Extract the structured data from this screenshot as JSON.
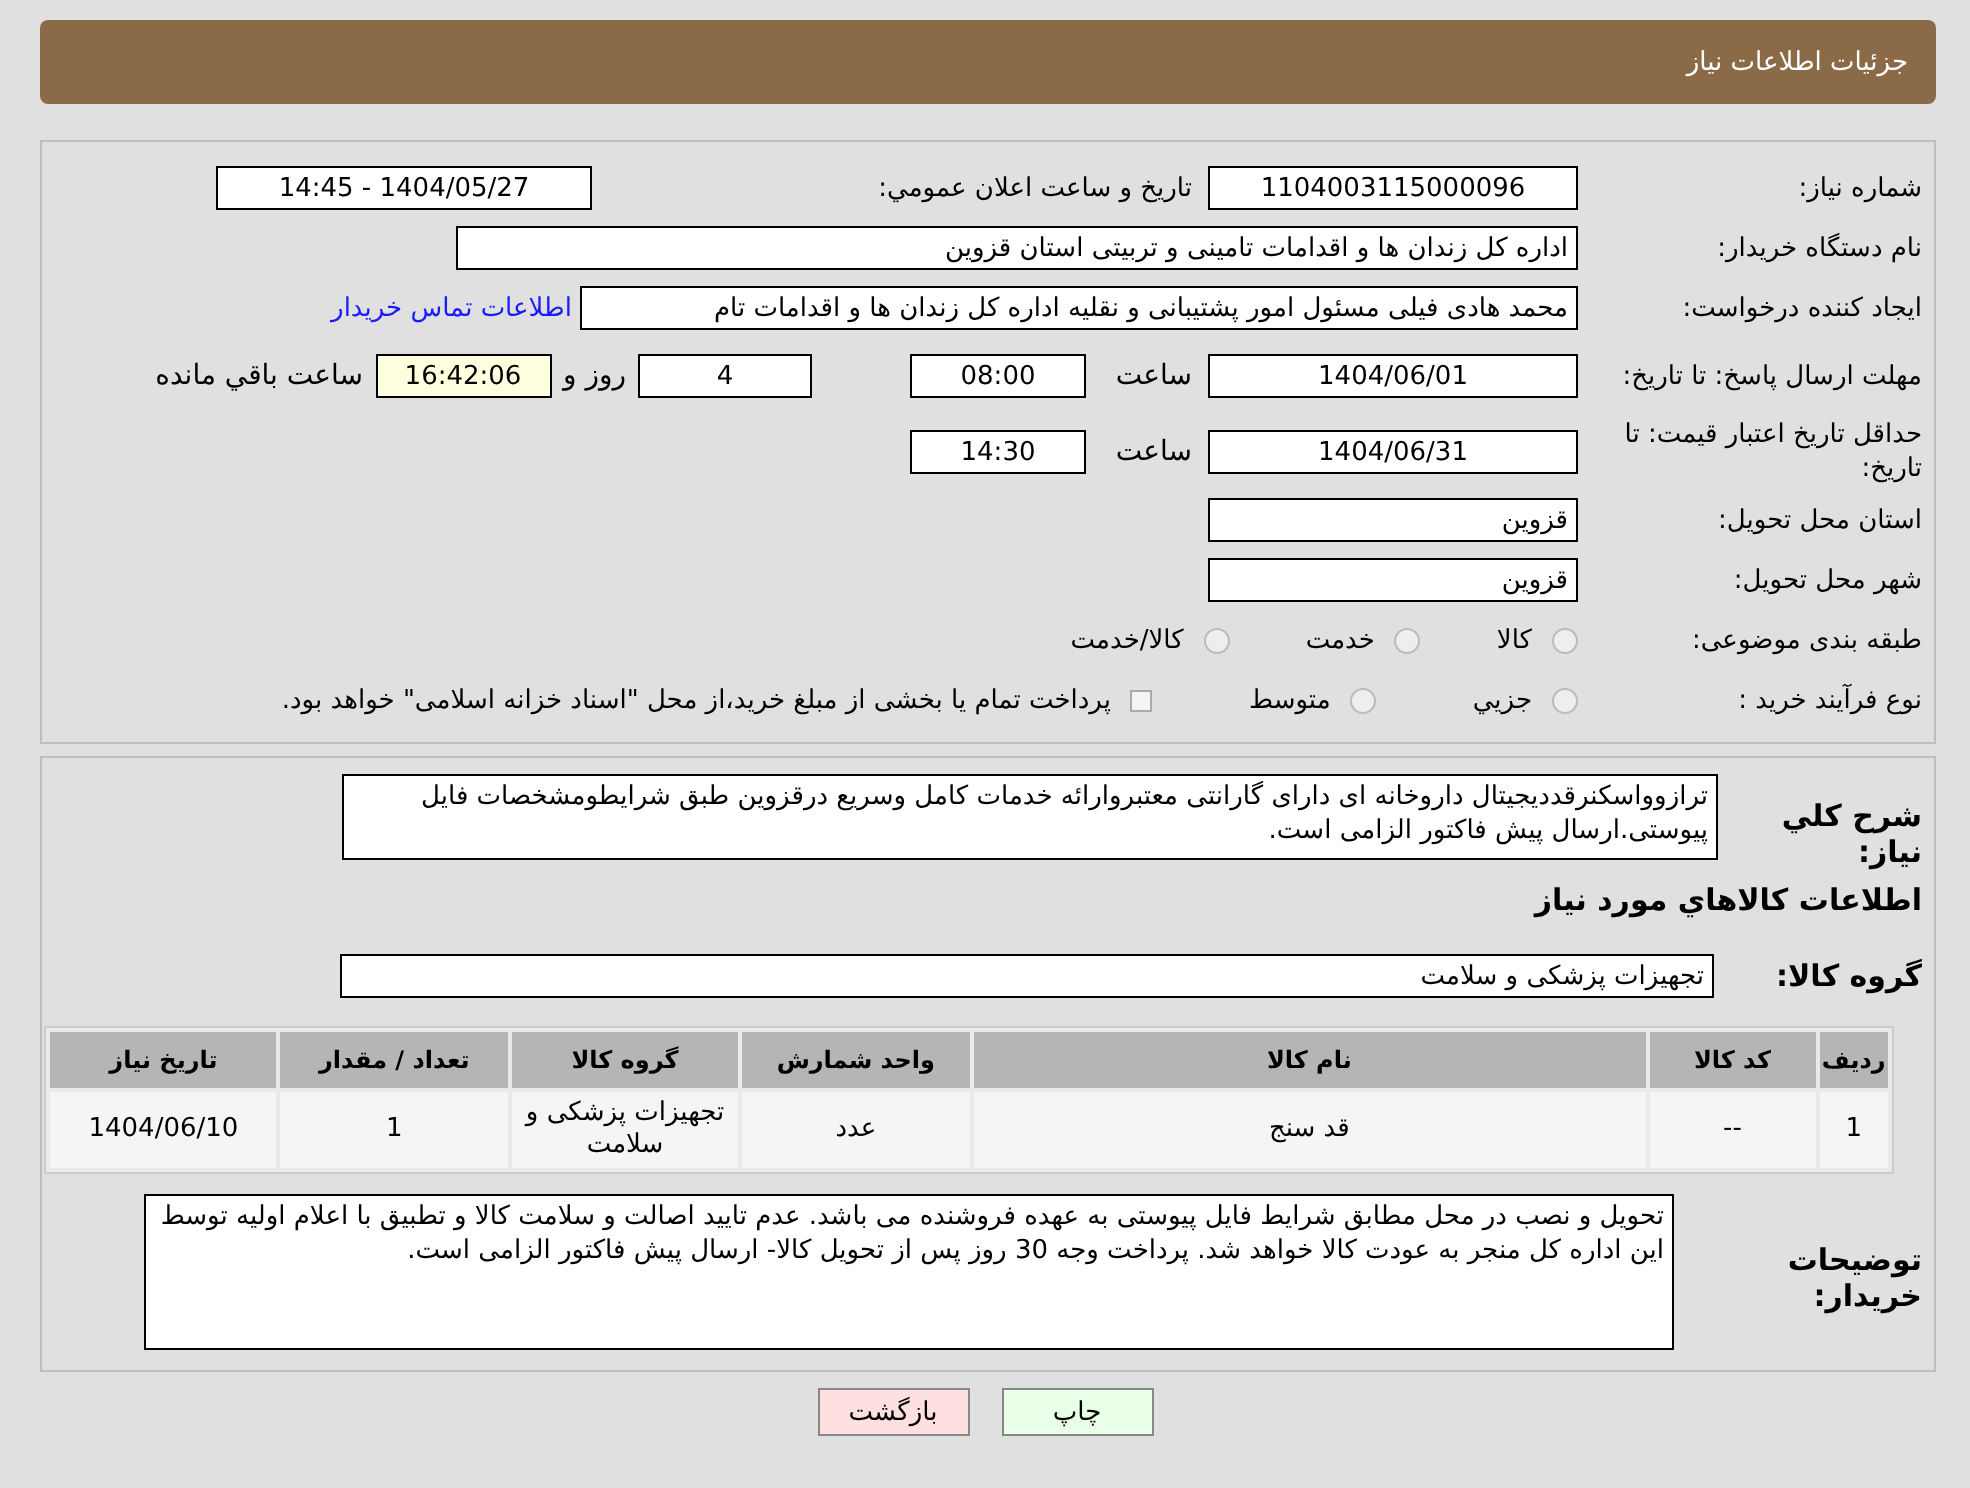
{
  "header": {
    "title": "جزئیات اطلاعات نیاز"
  },
  "need_number": {
    "label": "شماره نیاز:",
    "value": "1104003115000096"
  },
  "announce": {
    "label": "تاریخ و ساعت اعلان عمومي:",
    "value": "1404/05/27 - 14:45"
  },
  "buyer": {
    "label": "نام دستگاه خریدار:",
    "value": "اداره کل زندان ها و اقدامات تامینی و تربیتی استان قزوین"
  },
  "requester": {
    "label": "ایجاد کننده درخواست:",
    "value": "محمد هادی فیلی مسئول امور پشتیبانی و نقلیه اداره کل زندان ها و اقدامات تام",
    "link": "اطلاعات تماس خریدار"
  },
  "deadline": {
    "label": "مهلت ارسال پاسخ: تا تاریخ:",
    "date": "1404/06/01",
    "time_label": "ساعت",
    "time": "08:00",
    "days": "4",
    "days_label": "روز و",
    "remaining": "16:42:06",
    "remaining_label": "ساعت باقي مانده"
  },
  "validity": {
    "label": "حداقل تاریخ اعتبار قیمت: تا تاریخ:",
    "date": "1404/06/31",
    "time_label": "ساعت",
    "time": "14:30"
  },
  "province": {
    "label": "استان محل تحویل:",
    "value": "قزوین"
  },
  "city": {
    "label": "شهر محل تحویل:",
    "value": "قزوین"
  },
  "category": {
    "label": "طبقه بندی موضوعی:",
    "options": [
      {
        "label": "کالا",
        "selected": false
      },
      {
        "label": "خدمت",
        "selected": false
      },
      {
        "label": "کالا/خدمت",
        "selected": false
      }
    ]
  },
  "purchase_type": {
    "label": "نوع فرآیند خرید :",
    "options": [
      {
        "label": "جزيي",
        "selected": false
      },
      {
        "label": "متوسط",
        "selected": false
      }
    ],
    "treasury": {
      "checked": false,
      "text": "پرداخت تمام یا بخشی از مبلغ خرید،از محل \"اسناد خزانه اسلامی\" خواهد بود."
    }
  },
  "description": {
    "label": "شرح كلي نياز:",
    "value": "ترازوواسکنرقددیجیتال داروخانه ای دارای گارانتی معتبروارائه خدمات کامل وسریع درقزوین طبق شرایطومشخصات فایل پیوستی.ارسال پیش فاکتور الزامی است."
  },
  "goods_title": "اطلاعات كالاهاي مورد نياز",
  "goods_group": {
    "label": "گروه کالا:",
    "value": "تجهیزات پزشکی و سلامت"
  },
  "table": {
    "columns": [
      "ردیف",
      "کد کالا",
      "نام کالا",
      "واحد شمارش",
      "گروه کالا",
      "تعداد / مقدار",
      "تاریخ نیاز"
    ],
    "rows": [
      [
        "1",
        "--",
        "قد سنج",
        "عدد",
        "تجهیزات پزشکی و سلامت",
        "1",
        "1404/06/10"
      ]
    ]
  },
  "notes": {
    "label": "توضیحات خریدار:",
    "value": "تحویل و نصب در محل مطابق شرایط فایل پیوستی به عهده فروشنده می باشد. عدم تایید اصالت و سلامت کالا و تطبیق با اعلام اولیه توسط این اداره کل منجر به عودت کالا خواهد شد. پرداخت وجه 30 روز پس از تحویل کالا- ارسال پیش فاکتور الزامی است."
  },
  "buttons": [
    {
      "label": "چاپ",
      "kind": "print"
    },
    {
      "label": "بازگشت",
      "kind": "back"
    }
  ]
}
